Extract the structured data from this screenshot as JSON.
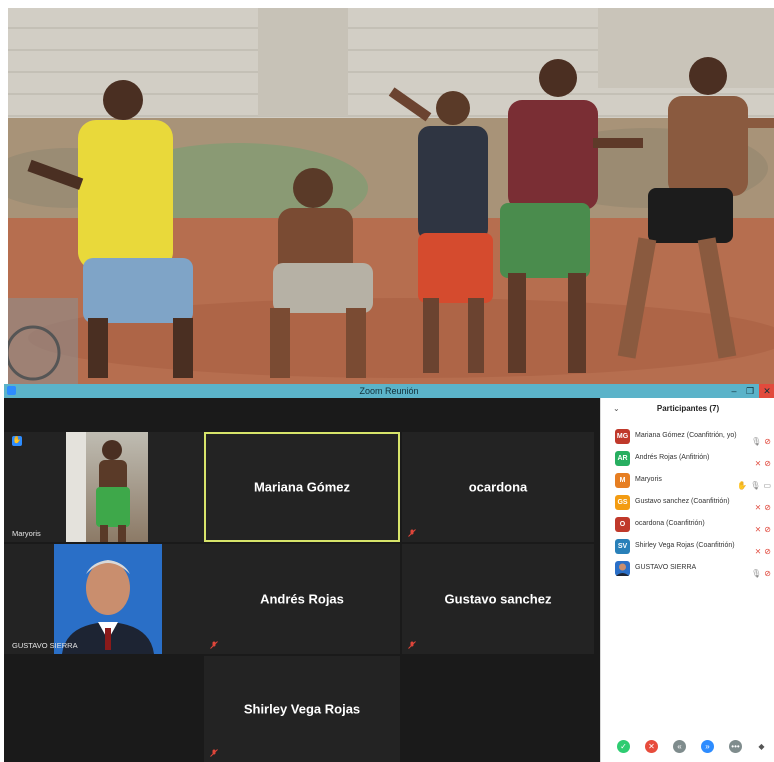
{
  "window": {
    "title": "Zoom Reunión",
    "minimize": "–",
    "restore": "❐",
    "close": "✕"
  },
  "gallery": {
    "tiles": [
      {
        "name": "Maryoris",
        "has_video": true,
        "hand_raised": true
      },
      {
        "name": "Mariana Gómez",
        "active_speaker": true
      },
      {
        "name": "ocardona",
        "muted": true
      },
      {
        "name": "GUSTAVO SIERRA",
        "has_video": true
      },
      {
        "name": "Andrés Rojas",
        "muted": true
      },
      {
        "name": "Gustavo sanchez",
        "muted": true
      },
      {
        "name": "Shirley Vega Rojas",
        "muted": true
      }
    ]
  },
  "participants": {
    "title": "Participantes (7)",
    "collapse_icon": "chevron-down-icon",
    "list": [
      {
        "initials": "MG",
        "color": "#c0392b",
        "name": "Mariana Gómez (Coanfitrión, yo)",
        "mic": "on",
        "video": "off"
      },
      {
        "initials": "AR",
        "color": "#27ae60",
        "name": "Andrés Rojas (Anfitrión)",
        "mic": "muted",
        "video": "off"
      },
      {
        "initials": "M",
        "color": "#e67e22",
        "name": "Maryoris",
        "hand": true,
        "mic": "on",
        "video": "on"
      },
      {
        "initials": "GS",
        "color": "#f39c12",
        "name": "Gustavo sanchez (Coanfitrión)",
        "mic": "muted",
        "video": "off"
      },
      {
        "initials": "O",
        "color": "#c0392b",
        "name": "ocardona (Coanfitrión)",
        "mic": "muted",
        "video": "off"
      },
      {
        "initials": "SV",
        "color": "#2980b9",
        "name": "Shirley Vega Rojas (Coanfitrión)",
        "mic": "muted",
        "video": "off"
      },
      {
        "initials": "",
        "color": "#7f8c8d",
        "name": "GUSTAVO SIERRA",
        "photo": true,
        "mic": "on",
        "video": "off"
      }
    ],
    "footer_icons": [
      "check-icon",
      "close-icon",
      "rewind-icon",
      "fast-forward-icon",
      "more-icon",
      "diamond-icon"
    ],
    "footer_colors": [
      "#2ecc71",
      "#e74c3c",
      "#7f8c8d",
      "#2d8cff",
      "#7f8c8d",
      "#555555"
    ]
  }
}
